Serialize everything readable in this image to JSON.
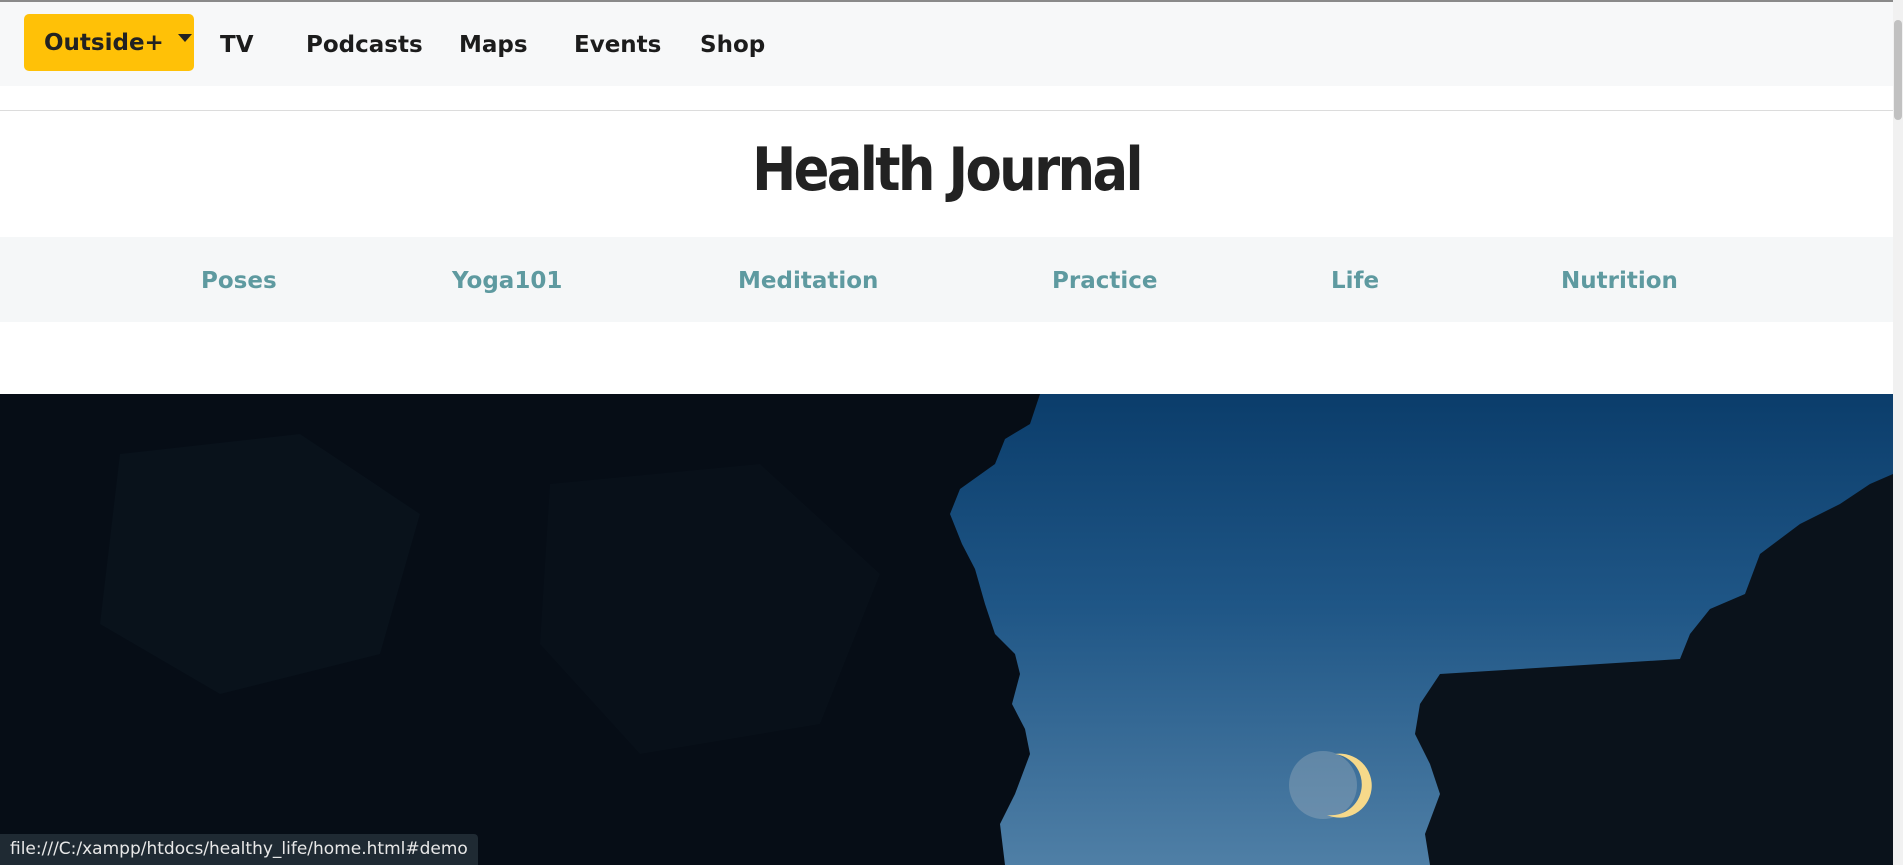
{
  "topnav": {
    "dropdown_label": "Outside+",
    "links": [
      "TV",
      "Podcasts",
      "Maps",
      "Events",
      "Shop"
    ]
  },
  "site": {
    "title": "Health Journal"
  },
  "categories": [
    "Poses",
    "Yoga101",
    "Meditation",
    "Practice",
    "Life",
    "Nutrition"
  ],
  "status_bar": {
    "url": "file:///C:/xampp/htdocs/healthy_life/home.html#demo"
  },
  "colors": {
    "accent": "#ffc107",
    "category_link": "#5e9aa0",
    "nav_text": "#1c1c1c"
  },
  "hero": {
    "icon": "crescent-moon-night-cliffs-image"
  }
}
